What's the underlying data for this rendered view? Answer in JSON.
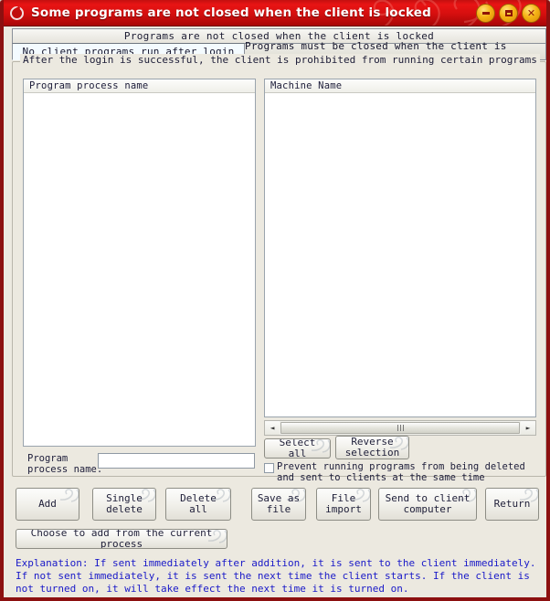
{
  "window": {
    "title": "Some programs are not closed when the client is locked",
    "icon": "app-circle-icon",
    "accent_color": "#d70f0f",
    "border_color": "#8c1010",
    "controls": [
      {
        "name": "minimize-button",
        "glyph": "minimize"
      },
      {
        "name": "maximize-button",
        "glyph": "maximize"
      },
      {
        "name": "close-button",
        "glyph": "close",
        "label": "✕"
      }
    ]
  },
  "tabs": {
    "caption": "Programs are not closed when the client is locked",
    "items": [
      {
        "label": "No client programs run after login",
        "selected": true
      },
      {
        "label": "Programs must be closed when the client is locked",
        "selected": false
      }
    ]
  },
  "group": {
    "legend": "After the login is successful, the client is prohibited from running certain programs",
    "left_list": {
      "column_header": "Program process name",
      "rows": []
    },
    "right_list": {
      "column_header": "Machine Name",
      "rows": []
    },
    "scrollbar": {
      "left_arrow": "◄",
      "right_arrow": "►"
    },
    "select_all_label": "Select all",
    "reverse_selection_label": "Reverse\nselection",
    "checkbox": {
      "label": "Prevent running programs from being deleted\nand sent to clients at the same time",
      "checked": false
    },
    "program_process_name": {
      "label": "Program\nprocess name:",
      "value": "",
      "placeholder": ""
    }
  },
  "buttons": {
    "add": "Add",
    "single_delete": "Single\ndelete",
    "delete_all": "Delete all",
    "save_as_file": "Save as\nfile",
    "file_import": "File\nimport",
    "send_to_client_computer": "Send to client\ncomputer",
    "return": "Return",
    "choose_from_current_process": "Choose to add from the current process"
  },
  "explanation": {
    "text": "Explanation: If sent immediately after addition, it is sent to the client immediately. If not sent immediately, it is sent the next time the client starts. If the client is not turned on, it will take effect the next time it is turned on.",
    "color": "#1919c8"
  }
}
